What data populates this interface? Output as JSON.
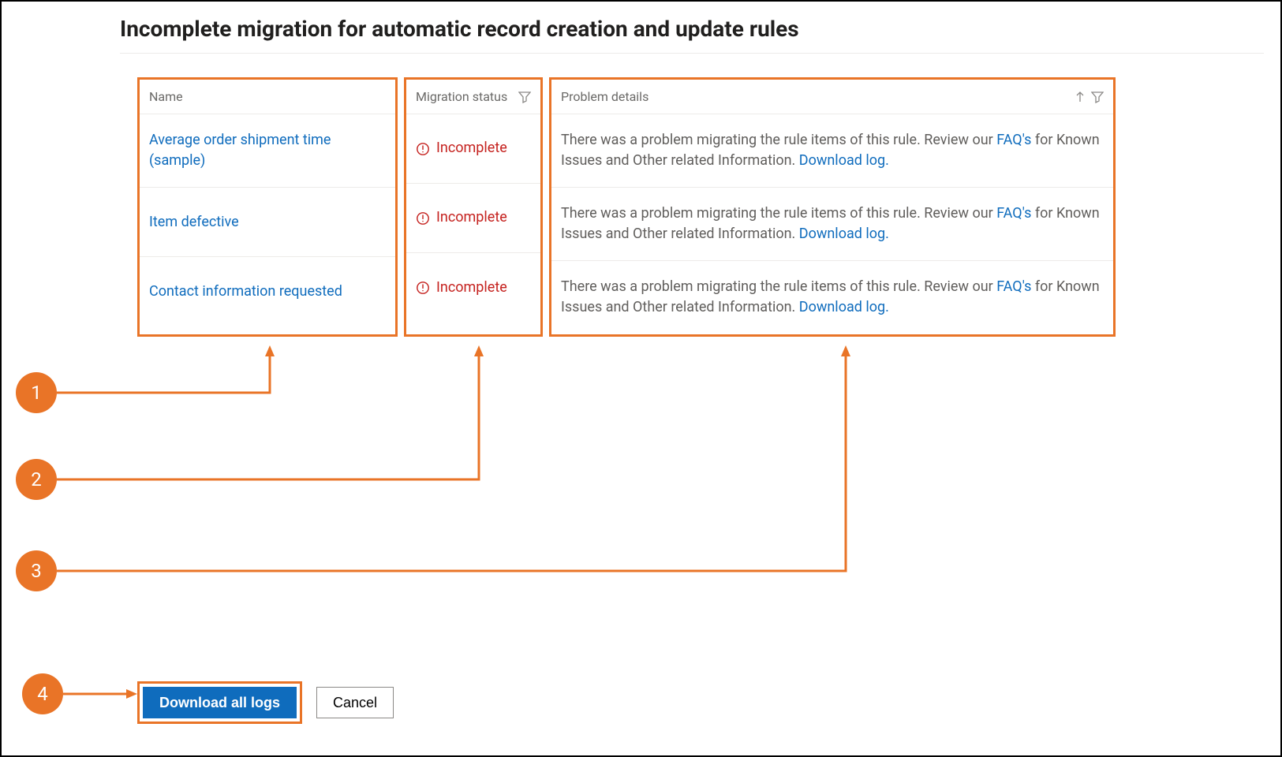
{
  "title": "Incomplete migration for automatic record creation and update rules",
  "columns": {
    "name": "Name",
    "status": "Migration status",
    "details": "Problem details"
  },
  "status_label": "Incomplete",
  "detail_prefix": "There was a problem migrating the rule items of this rule. Review our ",
  "faq_link": "FAQ's",
  "detail_mid": " for Known Issues and Other related Information. ",
  "download_log_link": "Download log.",
  "rows": [
    {
      "name": "Average order shipment time (sample)"
    },
    {
      "name": "Item defective"
    },
    {
      "name": "Contact information requested"
    }
  ],
  "callouts": [
    "1",
    "2",
    "3",
    "4"
  ],
  "buttons": {
    "download_all": "Download all logs",
    "cancel": "Cancel"
  }
}
